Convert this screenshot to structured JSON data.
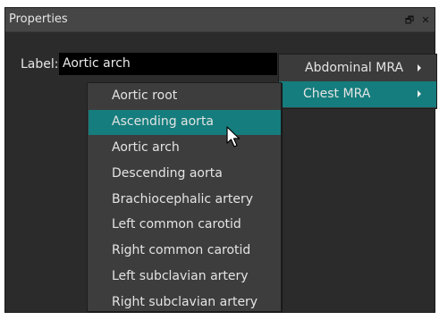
{
  "window": {
    "title": "Properties",
    "float_button": "🗗",
    "close_button": "✕"
  },
  "label_field": {
    "caption": "Label:",
    "value": "Aortic arch"
  },
  "menu": {
    "items": [
      {
        "label": "Abdominal MRA",
        "has_submenu": true
      },
      {
        "label": "Chest MRA",
        "has_submenu": true,
        "active": true
      }
    ]
  },
  "submenu": {
    "items": [
      {
        "label": "Aortic root"
      },
      {
        "label": "Ascending aorta",
        "active": true
      },
      {
        "label": "Aortic arch"
      },
      {
        "label": "Descending aorta"
      },
      {
        "label": "Brachiocephalic artery"
      },
      {
        "label": "Left common carotid"
      },
      {
        "label": "Right common carotid"
      },
      {
        "label": "Left subclavian artery"
      },
      {
        "label": "Right subclavian artery"
      }
    ]
  },
  "colors": {
    "highlight": "#157d7d",
    "panel_bg": "#2b2b2b",
    "titlebar_bg": "#464646",
    "input_bg": "#000000"
  }
}
